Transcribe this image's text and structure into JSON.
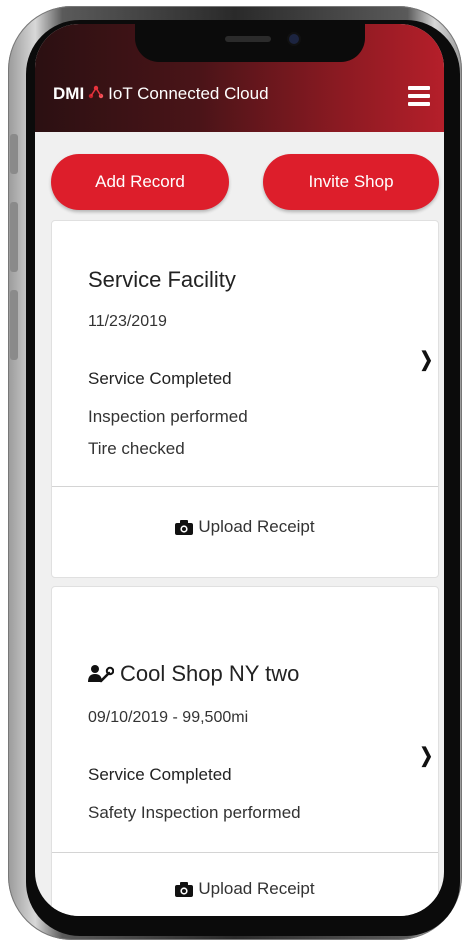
{
  "header": {
    "brand_prefix": "DMI",
    "brand_title": "IoT Connected Cloud"
  },
  "actions": {
    "add_record": "Add Record",
    "invite_shop": "Invite Shop"
  },
  "records": [
    {
      "title": "Service Facility",
      "date": "11/23/2019",
      "status": "Service Completed",
      "notes": [
        "Inspection performed",
        "Tire checked"
      ],
      "upload_label": "Upload Receipt"
    },
    {
      "title": "Cool Shop NY two",
      "date": "09/10/2019 - 99,500mi",
      "status": "Service Completed",
      "notes": [
        "Safety Inspection performed"
      ],
      "upload_label": "Upload Receipt",
      "icon": "user-wrench-icon"
    }
  ],
  "colors": {
    "accent": "#dd1e2b",
    "header_dark": "#2b1012",
    "header_light": "#b51f2a"
  }
}
